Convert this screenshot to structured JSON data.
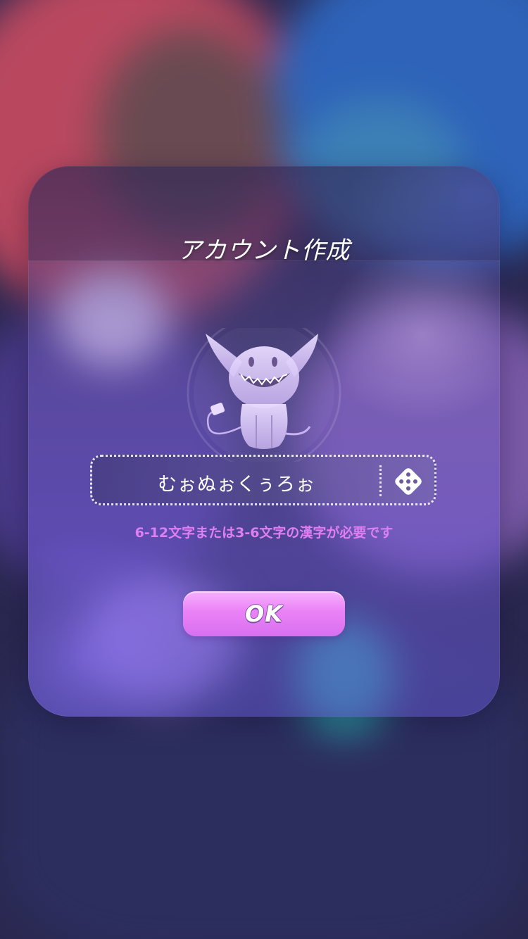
{
  "dialog": {
    "title": "アカウント作成",
    "avatar_icon": "grinning-horned-mascot-icon",
    "name_input": {
      "value": "むぉぬぉくぅろぉ"
    },
    "randomize_icon": "dice-icon",
    "hint": "6-12文字または3-6文字の漢字が必要です",
    "ok_label": "OK"
  },
  "colors": {
    "hint_text": "#e07ff2",
    "ok_button": "#ea82f6",
    "dialog_tint": "#7a64d2"
  }
}
